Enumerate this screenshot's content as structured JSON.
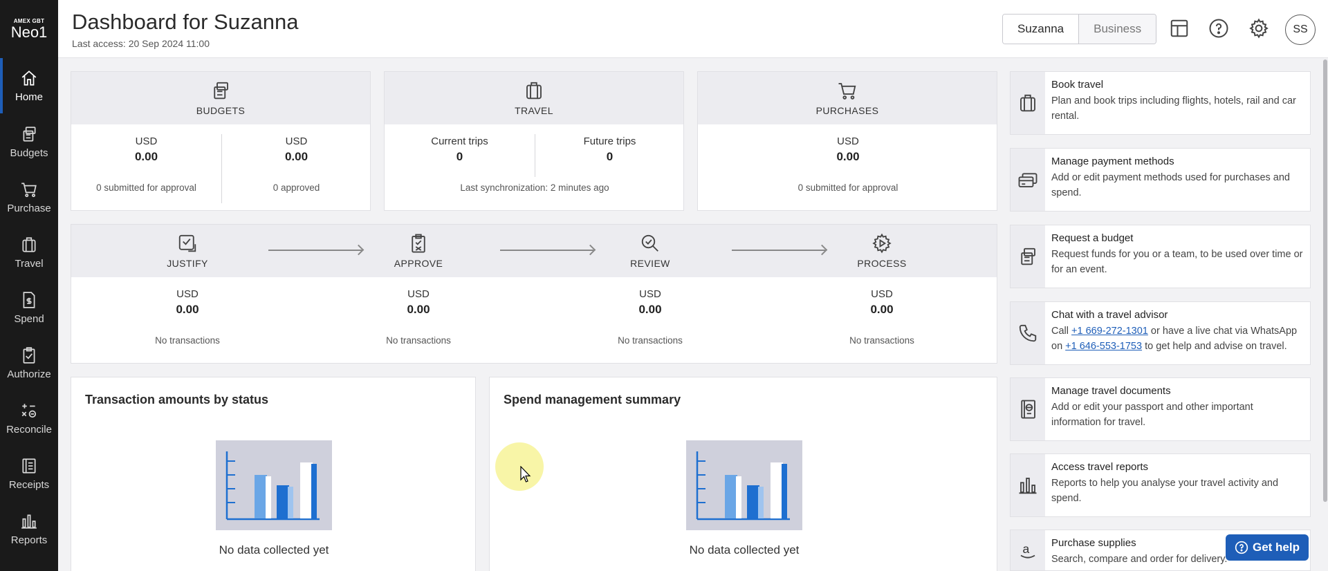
{
  "app": {
    "logo_top": "AMEX GBT",
    "logo_main": "Neo1"
  },
  "sidebar": {
    "items": [
      {
        "label": "Home",
        "icon": "home-icon",
        "active": true
      },
      {
        "label": "Budgets",
        "icon": "budgets-icon"
      },
      {
        "label": "Purchase",
        "icon": "cart-icon"
      },
      {
        "label": "Travel",
        "icon": "suitcase-icon"
      },
      {
        "label": "Spend",
        "icon": "spend-icon"
      },
      {
        "label": "Authorize",
        "icon": "authorize-icon"
      },
      {
        "label": "Reconcile",
        "icon": "reconcile-icon"
      },
      {
        "label": "Receipts",
        "icon": "receipts-icon"
      },
      {
        "label": "Reports",
        "icon": "reports-icon"
      }
    ]
  },
  "header": {
    "title": "Dashboard for Suzanna",
    "last_access": "Last access: 20 Sep 2024 11:00",
    "toggle": [
      "Suzanna",
      "Business"
    ],
    "avatar": "SS"
  },
  "budgets": {
    "title": "BUDGETS",
    "left": {
      "currency": "USD",
      "value": "0.00",
      "sub": "0 submitted for approval"
    },
    "right": {
      "currency": "USD",
      "value": "0.00",
      "sub": "0 approved"
    }
  },
  "travel": {
    "title": "TRAVEL",
    "left": {
      "label": "Current trips",
      "value": "0"
    },
    "right": {
      "label": "Future trips",
      "value": "0"
    },
    "sync": "Last synchronization: 2 minutes ago"
  },
  "purchases": {
    "title": "PURCHASES",
    "currency": "USD",
    "value": "0.00",
    "sub": "0 submitted for approval"
  },
  "workflow": {
    "steps": [
      {
        "title": "JUSTIFY",
        "currency": "USD",
        "value": "0.00",
        "sub": "No transactions"
      },
      {
        "title": "APPROVE",
        "currency": "USD",
        "value": "0.00",
        "sub": "No transactions"
      },
      {
        "title": "REVIEW",
        "currency": "USD",
        "value": "0.00",
        "sub": "No transactions"
      },
      {
        "title": "PROCESS",
        "currency": "USD",
        "value": "0.00",
        "sub": "No transactions"
      }
    ]
  },
  "panels": {
    "transactions": {
      "title": "Transaction amounts by status",
      "empty": "No data collected yet"
    },
    "spend": {
      "title": "Spend management summary",
      "empty": "No data collected yet"
    }
  },
  "actions": [
    {
      "title": "Book travel",
      "desc": "Plan and book trips including flights, hotels, rail and car rental.",
      "icon": "suitcase-icon"
    },
    {
      "title": "Manage payment methods",
      "desc": "Add or edit payment methods used for purchases and spend.",
      "icon": "cards-icon"
    },
    {
      "title": "Request a budget",
      "desc": "Request funds for you or a team, to be used over time or for an event.",
      "icon": "budgets-icon"
    },
    {
      "title": "Chat with a travel advisor",
      "desc_pre": "Call ",
      "phone1": "+1 669-272-1301",
      "desc_mid": " or have a live chat via WhatsApp on ",
      "phone2": "+1 646-553-1753",
      "desc_post": " to get help and advise on travel.",
      "icon": "phone-icon"
    },
    {
      "title": "Manage travel documents",
      "desc": "Add or edit your passport and other important information for travel.",
      "icon": "passport-icon"
    },
    {
      "title": "Access travel reports",
      "desc": "Reports to help you analyse your travel activity and spend.",
      "icon": "reports-icon"
    },
    {
      "title": "Purchase supplies",
      "desc": "Search, compare and order for delivery.",
      "icon": "amazon-icon"
    }
  ],
  "get_help": "Get help",
  "colors": {
    "accent": "#1e5eb8",
    "sidebar": "#1a1a1a"
  }
}
